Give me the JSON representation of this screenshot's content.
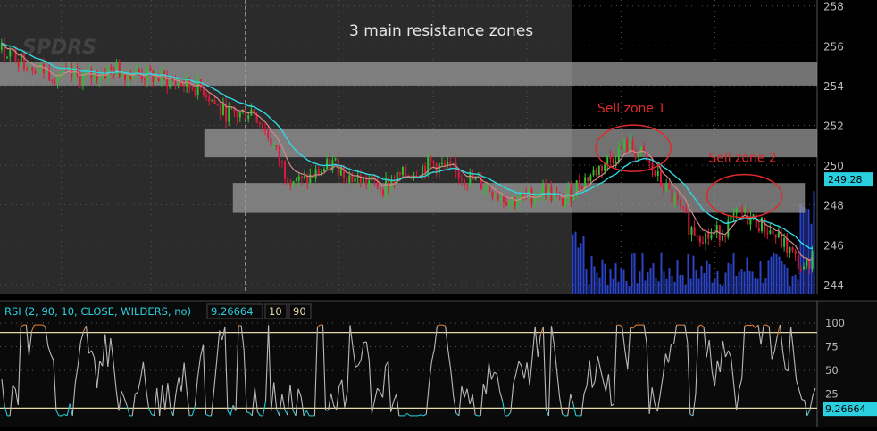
{
  "colors": {
    "background": "#000000",
    "history_shade": "#2b2b2b",
    "zone_fill": "#9e9e9e",
    "up_candle": "#2fbf2f",
    "down_candle": "#e0183c",
    "ema_fast": "#d08a8a",
    "ema_slow": "#33d6e0",
    "volume": "#2b45c8",
    "annotation": "#e02a2a",
    "rsi_line": "#b9b9b9",
    "rsi_overbought": "#e07a30",
    "rsi_oversold": "#25c7d6",
    "rsi_level": "#e8d9a8",
    "axis_text": "#b8b8b8",
    "price_badge": "#2ad0e0"
  },
  "chart_data": [
    {
      "type": "candlestick",
      "title": "3 main resistance zones",
      "watermark": "SPDRS",
      "ylim": [
        243.5,
        258.3
      ],
      "yticks": [
        244,
        246,
        248,
        250,
        252,
        254,
        256,
        258
      ],
      "last_price": "249.28",
      "resistance_zones": [
        {
          "low": 254.0,
          "high": 255.2,
          "x_start_fraction": 0.0,
          "x_end_fraction": 1.0
        },
        {
          "low": 250.4,
          "high": 251.8,
          "x_start_fraction": 0.25,
          "x_end_fraction": 1.0
        },
        {
          "low": 247.6,
          "high": 249.1,
          "x_start_fraction": 0.285,
          "x_end_fraction": 0.985
        }
      ],
      "annotations": [
        {
          "text": "Sell zone 1",
          "price": 250.85,
          "x_fraction": 0.775
        },
        {
          "text": "Sell zone 2",
          "price": 248.45,
          "x_fraction": 0.911
        }
      ],
      "close_path": [
        [
          0,
          255.8
        ],
        [
          0.03,
          255.2
        ],
        [
          0.06,
          254.6
        ],
        [
          0.1,
          254.4
        ],
        [
          0.14,
          254.8
        ],
        [
          0.18,
          254.5
        ],
        [
          0.22,
          254.1
        ],
        [
          0.25,
          253.8
        ],
        [
          0.27,
          252.7
        ],
        [
          0.29,
          252.5
        ],
        [
          0.31,
          252.8
        ],
        [
          0.33,
          251.4
        ],
        [
          0.35,
          249.6
        ],
        [
          0.37,
          249.1
        ],
        [
          0.39,
          249.6
        ],
        [
          0.41,
          250.1
        ],
        [
          0.43,
          249.4
        ],
        [
          0.45,
          249.2
        ],
        [
          0.47,
          248.9
        ],
        [
          0.49,
          249.4
        ],
        [
          0.51,
          249.7
        ],
        [
          0.53,
          250.1
        ],
        [
          0.55,
          249.8
        ],
        [
          0.57,
          249.4
        ],
        [
          0.59,
          249.1
        ],
        [
          0.61,
          248.6
        ],
        [
          0.63,
          248.2
        ],
        [
          0.65,
          248.4
        ],
        [
          0.67,
          248.8
        ],
        [
          0.69,
          248.1
        ],
        [
          0.71,
          249.0
        ],
        [
          0.73,
          249.6
        ],
        [
          0.75,
          250.3
        ],
        [
          0.77,
          251.0
        ],
        [
          0.79,
          250.5
        ],
        [
          0.81,
          249.3
        ],
        [
          0.83,
          248.2
        ],
        [
          0.85,
          246.8
        ],
        [
          0.87,
          246.4
        ],
        [
          0.89,
          246.7
        ],
        [
          0.91,
          247.6
        ],
        [
          0.93,
          247.2
        ],
        [
          0.95,
          246.6
        ],
        [
          0.97,
          245.8
        ],
        [
          0.99,
          244.6
        ],
        [
          1.0,
          245.6
        ]
      ],
      "volume_start_fraction": 0.7
    },
    {
      "type": "line",
      "indicator": "RSI",
      "legend": {
        "label": "RSI (2, 90, 10, CLOSE, WILDERS, no)",
        "value": "9.26664",
        "oversold": "10",
        "overbought": "90"
      },
      "ylim": [
        0,
        100
      ],
      "yticks": [
        25,
        50,
        75,
        100
      ],
      "levels": [
        10,
        90
      ],
      "last_value": "9.26664"
    }
  ]
}
